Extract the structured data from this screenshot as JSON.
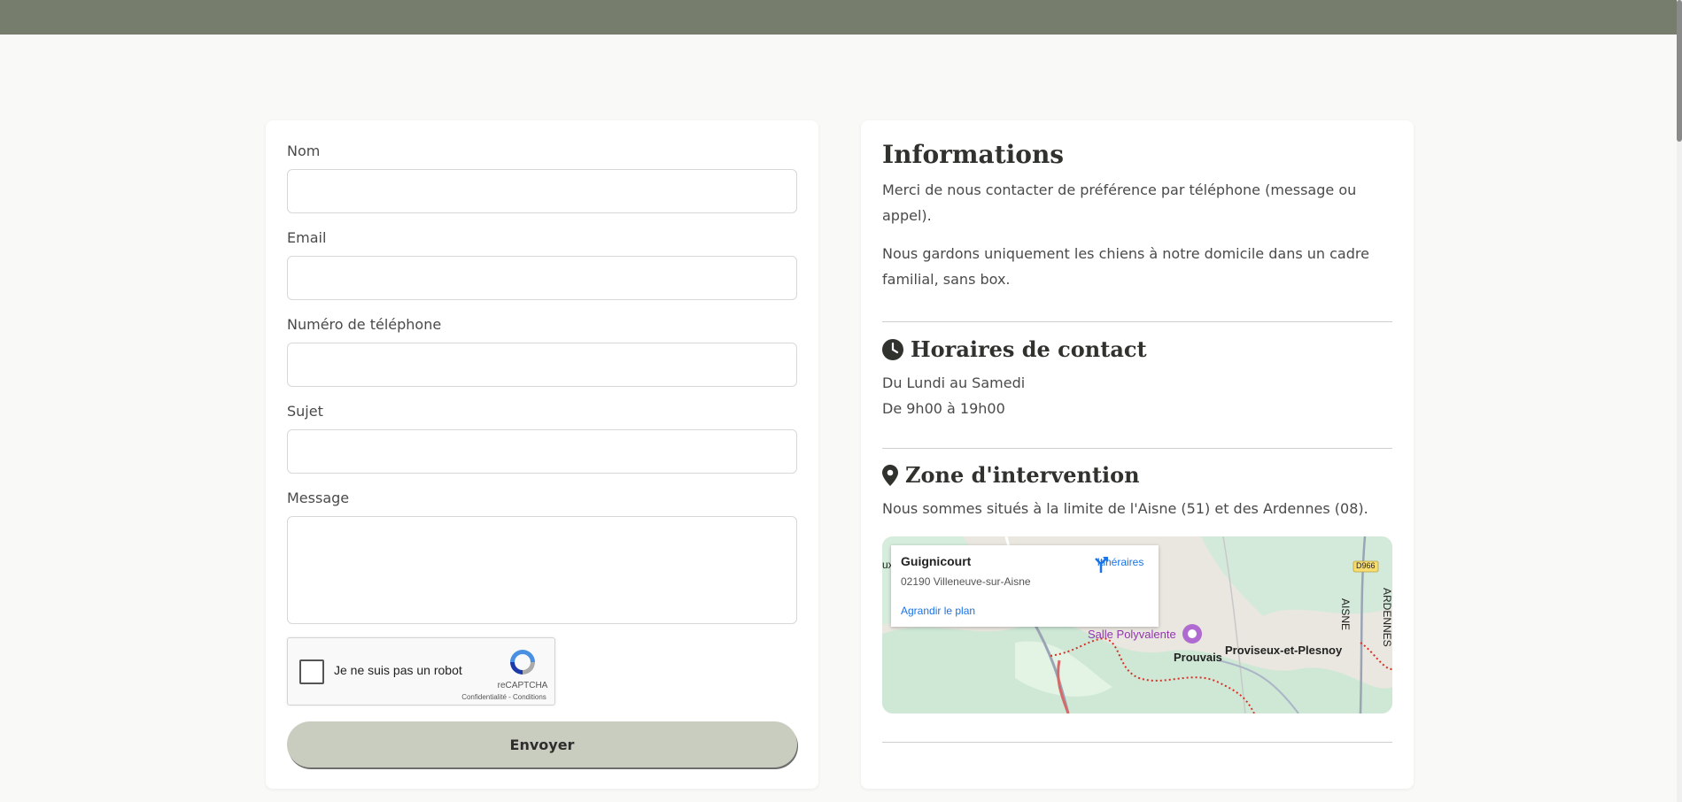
{
  "form": {
    "fields": [
      {
        "label": "Nom",
        "value": ""
      },
      {
        "label": "Email",
        "value": ""
      },
      {
        "label": "Numéro de téléphone",
        "value": ""
      },
      {
        "label": "Sujet",
        "value": ""
      },
      {
        "label": "Message",
        "value": ""
      }
    ],
    "recaptcha": {
      "label": "Je ne suis pas un robot",
      "brand": "reCAPTCHA",
      "links": "Confidentialité - Conditions"
    },
    "submit_label": "Envoyer"
  },
  "info": {
    "title": "Informations",
    "paragraphs": [
      "Merci de nous contacter de préférence par téléphone (message ou appel).",
      "Nous gardons uniquement les chiens à notre domicile dans un cadre familial, sans box."
    ],
    "hours": {
      "title": "Horaires de contact",
      "lines": [
        "Du Lundi au Samedi",
        "De 9h00 à 19h00"
      ]
    },
    "zone": {
      "title": "Zone d'intervention",
      "text": "Nous sommes situés à la limite de l'Aisne (51) et des Ardennes (08)."
    }
  },
  "map": {
    "place_name": "Guignicourt",
    "address": "02190 Villeneuve-sur-Aisne",
    "directions_label": "Itinéraires",
    "enlarge_label": "Agrandir le plan",
    "labels": {
      "poi": "Salle Polyvalente",
      "town1": "Prouvais",
      "town2": "Proviseux-et-Plesnoy",
      "road": "D966",
      "region1": "AISNE",
      "region2": "ARDENNES",
      "edge": "ux"
    }
  },
  "colors": {
    "topbar": "#767d6d",
    "button": "#c9cdbf",
    "accent_link": "#1a73e8"
  },
  "icons": {
    "hours": "clock-icon",
    "zone": "map-pin-icon",
    "directions": "directions-icon",
    "poi": "poi-icon"
  }
}
